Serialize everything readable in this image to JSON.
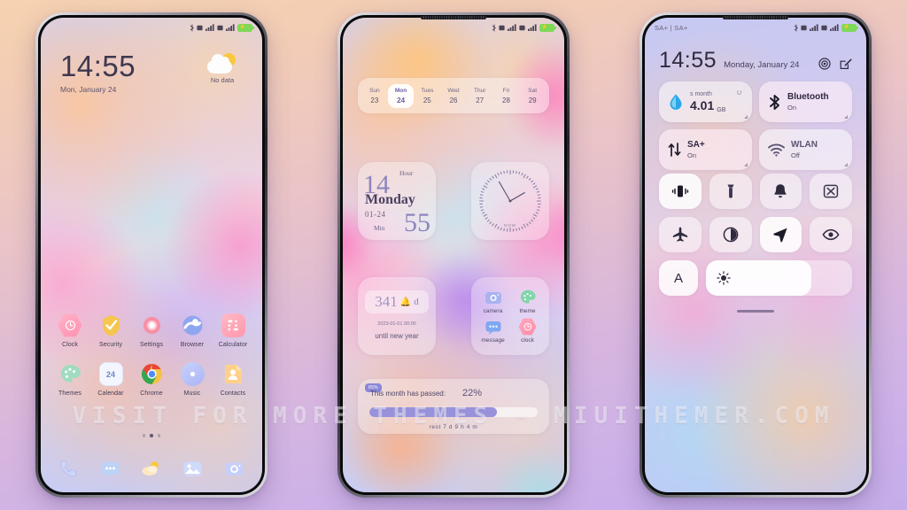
{
  "watermark": "VISIT FOR MORE THEMES - MIUITHEMER.COM",
  "status_bar": {
    "carrier": "SA+ | SA+",
    "icons": [
      "bluetooth-icon",
      "sim1-icon",
      "signal1-icon",
      "sim2-icon",
      "signal2-icon",
      "battery-icon"
    ]
  },
  "phone_left": {
    "name": "Home screen",
    "clock": {
      "time": "14:55",
      "date": "Mon, January 24"
    },
    "weather": {
      "status": "No data",
      "icon": "partly-cloudy-icon"
    },
    "apps": [
      {
        "label": "Clock",
        "icon": "clock-icon"
      },
      {
        "label": "Security",
        "icon": "shield-check-icon"
      },
      {
        "label": "Settings",
        "icon": "gear-icon"
      },
      {
        "label": "Browser",
        "icon": "browser-icon"
      },
      {
        "label": "Calculator",
        "icon": "calculator-icon"
      },
      {
        "label": "Themes",
        "icon": "palette-icon"
      },
      {
        "label": "Calendar",
        "icon": "calendar-icon",
        "badge": "24"
      },
      {
        "label": "Chrome",
        "icon": "chrome-icon"
      },
      {
        "label": "Music",
        "icon": "music-icon"
      },
      {
        "label": "Contacts",
        "icon": "contacts-icon"
      }
    ],
    "page_dots": {
      "count": 3,
      "active": 1
    },
    "dock": [
      {
        "label": "Phone",
        "icon": "phone-icon"
      },
      {
        "label": "Messages",
        "icon": "message-icon"
      },
      {
        "label": "Weather",
        "icon": "weather-icon"
      },
      {
        "label": "Gallery",
        "icon": "gallery-icon"
      },
      {
        "label": "Camera",
        "icon": "camera-icon"
      }
    ]
  },
  "phone_mid": {
    "name": "Widget screen",
    "calendar": {
      "days": [
        {
          "dow": "Sun",
          "num": "23",
          "selected": false
        },
        {
          "dow": "Mon",
          "num": "24",
          "selected": true
        },
        {
          "dow": "Tues",
          "num": "25",
          "selected": false
        },
        {
          "dow": "Wed",
          "num": "26",
          "selected": false
        },
        {
          "dow": "Thur",
          "num": "27",
          "selected": false
        },
        {
          "dow": "Fri",
          "num": "28",
          "selected": false
        },
        {
          "dow": "Sat",
          "num": "29",
          "selected": false
        }
      ]
    },
    "time_widget": {
      "hour_label": "Hour",
      "hour": "14",
      "weekday": "Monday",
      "date": "01-24",
      "min_label": "Min",
      "minute": "55"
    },
    "analog_clock": {
      "label": "NOW",
      "hour_angle": 60,
      "minute_angle": 330
    },
    "countdown": {
      "days": "341",
      "bell": "🔔",
      "unit": "d",
      "target": "2023-01-01 00:00",
      "caption": "until new year"
    },
    "shortcuts": [
      {
        "label": "camera",
        "icon": "camera-icon"
      },
      {
        "label": "theme",
        "icon": "palette-icon"
      },
      {
        "label": "message",
        "icon": "message-icon"
      },
      {
        "label": "clock",
        "icon": "clock-icon"
      }
    ],
    "progress": {
      "badge": "85%",
      "title": "This month has passed:",
      "percent": "22%",
      "fill": 76,
      "rest": "rest 7 d  9 h  4 m"
    }
  },
  "phone_right": {
    "name": "Control center",
    "header": {
      "time": "14:55",
      "date": "Monday, January 24",
      "icons": [
        "settings-gear-icon",
        "edit-icon"
      ]
    },
    "big_tiles": [
      {
        "kind": "data",
        "head": "s month",
        "value": "4.01",
        "unit": "GB",
        "right_mark": "U",
        "icon": "data-drop-icon"
      },
      {
        "kind": "toggle",
        "title": "Bluetooth",
        "sub": "On",
        "icon": "bluetooth-icon"
      },
      {
        "kind": "toggle",
        "title": "SA+",
        "sub": "On",
        "icon": "mobile-data-icon"
      },
      {
        "kind": "toggle",
        "title": "WLAN",
        "sub": "Off",
        "icon": "wifi-icon"
      }
    ],
    "small_tiles": [
      {
        "name": "vibrate-icon",
        "on": true
      },
      {
        "name": "flashlight-icon",
        "on": false
      },
      {
        "name": "bell-icon",
        "on": false
      },
      {
        "name": "screenshot-icon",
        "on": false
      },
      {
        "name": "airplane-icon",
        "on": false
      },
      {
        "name": "dark-mode-icon",
        "on": false
      },
      {
        "name": "location-icon",
        "on": true
      },
      {
        "name": "eye-comfort-icon",
        "on": false
      }
    ],
    "brightness": {
      "auto_label": "A",
      "icon": "brightness-sun-icon",
      "level": 72
    }
  },
  "colors": {
    "accent": "#8b87d8",
    "battery": "#7ed957",
    "progress_fill": "#9892db",
    "sun": "#fac83c"
  }
}
